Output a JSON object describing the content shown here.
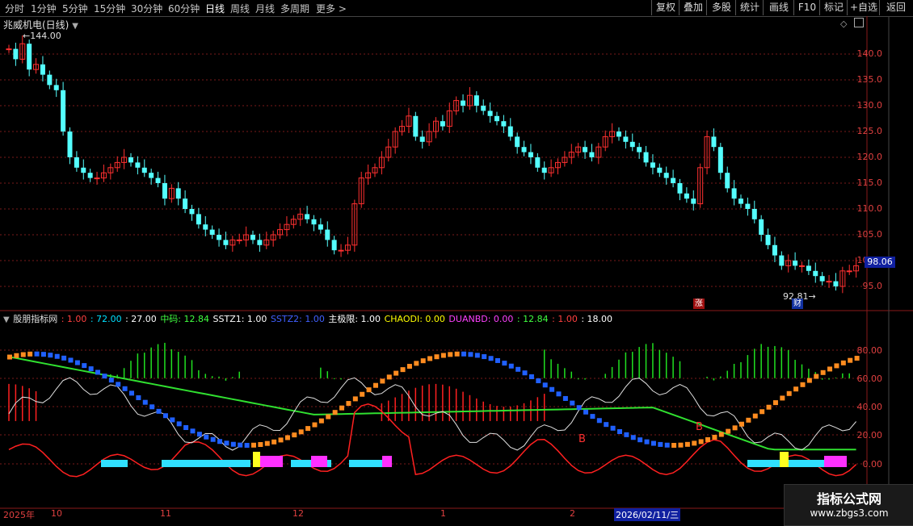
{
  "toolbar": {
    "periods": [
      "分时",
      "1分钟",
      "5分钟",
      "15分钟",
      "30分钟",
      "60分钟",
      "日线",
      "周线",
      "月线",
      "多周期",
      "更多 >"
    ],
    "active_period": "日线",
    "buttons": [
      "复权",
      "叠加",
      "多股",
      "统计",
      "画线",
      "F10",
      "标记",
      "+自选",
      "返回"
    ]
  },
  "main_chart": {
    "title": "兆威机电(日线)",
    "high_label": "144.00",
    "low_label": "92.81",
    "current_price": "98.06",
    "price_ticks": [
      "140.0",
      "135.0",
      "130.0",
      "125.0",
      "120.0",
      "115.0",
      "110.0",
      "105.0",
      "100.0",
      "95.0"
    ],
    "badge_up": "涨",
    "badge_fin": "财"
  },
  "indicator": {
    "name": "股朋指标网",
    "items": [
      {
        "label": ": 1.00",
        "color": "#ff4040"
      },
      {
        "label": ": 72.00",
        "color": "#00e0ff"
      },
      {
        "label": ": 27.00",
        "color": "#ffffff"
      },
      {
        "label": "中码: 12.84",
        "color": "#40ff40"
      },
      {
        "label": "SSTZ1: 1.00",
        "color": "#ffffff"
      },
      {
        "label": "SSTZ2: 1.00",
        "color": "#4060ff"
      },
      {
        "label": "主极限: 1.00",
        "color": "#ffffff"
      },
      {
        "label": "CHAODI: 0.00",
        "color": "#ffff00"
      },
      {
        "label": "DUANBD: 0.00",
        "color": "#ff40ff"
      },
      {
        "label": ": 12.84",
        "color": "#40ff40"
      },
      {
        "label": ": 1.00",
        "color": "#ff4040"
      },
      {
        "label": ": 18.00",
        "color": "#ffffff"
      }
    ],
    "y_ticks": [
      "80.00",
      "60.00",
      "40.00",
      "20.00",
      "0.00"
    ],
    "markers": [
      "B",
      "B"
    ]
  },
  "x_axis": {
    "labels": [
      "2025年",
      "10",
      "11",
      "12",
      "1",
      "2",
      "2026/02/11/三"
    ]
  },
  "watermark": {
    "line1": "指标公式网",
    "line2": "www.zbgs3.com"
  },
  "colors": {
    "up": "#ff3030",
    "down": "#54ffff",
    "grid": "#7a1a1a"
  }
}
